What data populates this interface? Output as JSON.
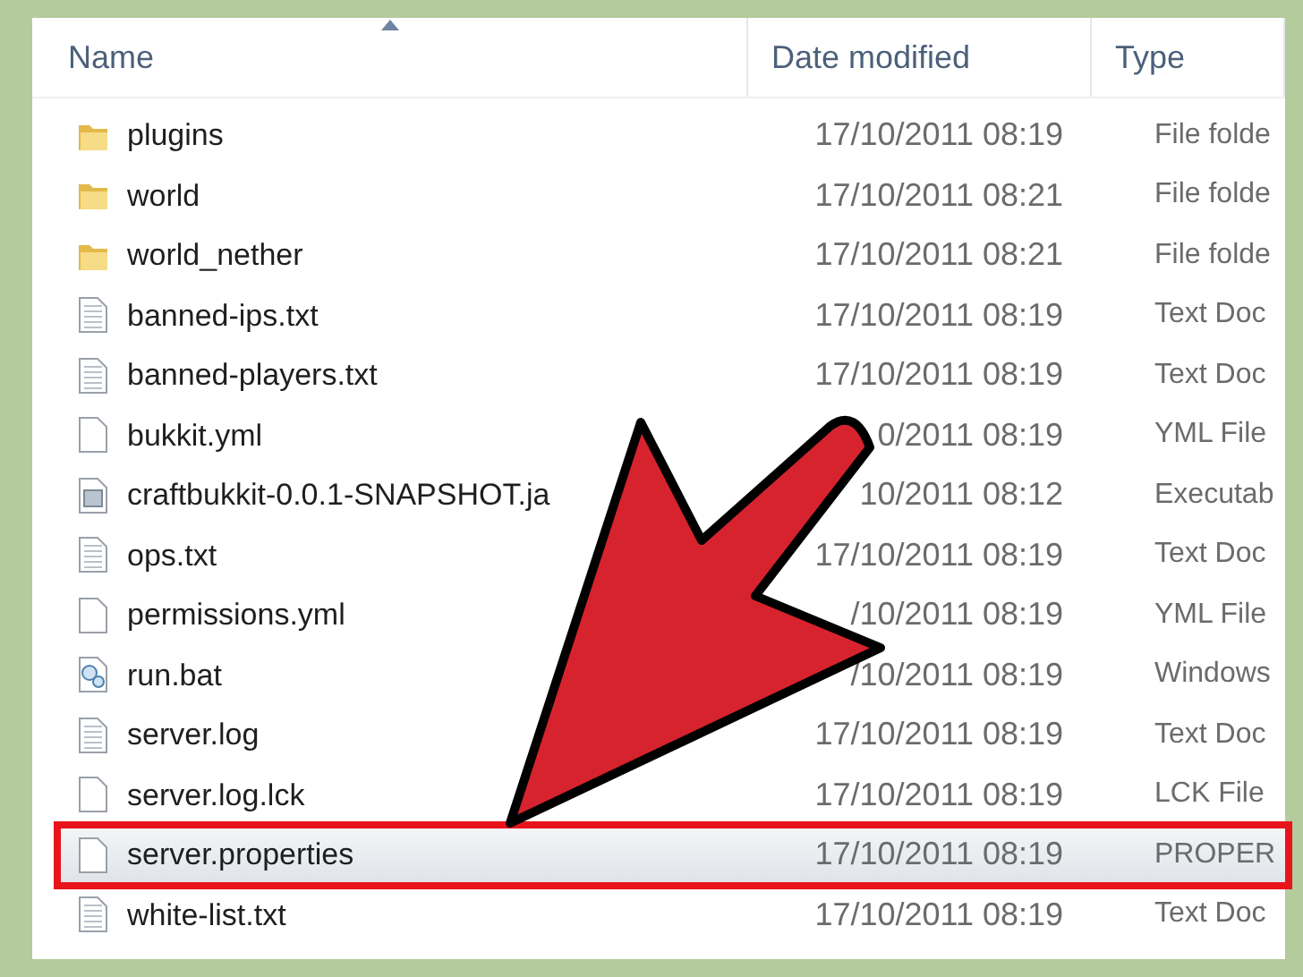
{
  "columns": [
    {
      "label": "Name",
      "sorted": true
    },
    {
      "label": "Date modified",
      "sorted": false
    },
    {
      "label": "Type",
      "sorted": false
    }
  ],
  "rows": [
    {
      "kind": "folder",
      "name": "plugins",
      "date": "17/10/2011 08:19",
      "type": "File folde",
      "selected": false
    },
    {
      "kind": "folder",
      "name": "world",
      "date": "17/10/2011 08:21",
      "type": "File folde",
      "selected": false
    },
    {
      "kind": "folder",
      "name": "world_nether",
      "date": "17/10/2011 08:21",
      "type": "File folde",
      "selected": false
    },
    {
      "kind": "text",
      "name": "banned-ips.txt",
      "date": "17/10/2011 08:19",
      "type": "Text Doc",
      "selected": false
    },
    {
      "kind": "text",
      "name": "banned-players.txt",
      "date": "17/10/2011 08:19",
      "type": "Text Doc",
      "selected": false
    },
    {
      "kind": "blank",
      "name": "bukkit.yml",
      "date": "0/2011 08:19",
      "type": "YML File",
      "selected": false
    },
    {
      "kind": "jar",
      "name": "craftbukkit-0.0.1-SNAPSHOT.ja",
      "date": "10/2011 08:12",
      "type": "Executab",
      "selected": false
    },
    {
      "kind": "text",
      "name": "ops.txt",
      "date": "17/10/2011 08:19",
      "type": "Text Doc",
      "selected": false
    },
    {
      "kind": "blank",
      "name": "permissions.yml",
      "date": "/10/2011 08:19",
      "type": "YML File",
      "selected": false
    },
    {
      "kind": "bat",
      "name": "run.bat",
      "date": "/10/2011 08:19",
      "type": "Windows",
      "selected": false
    },
    {
      "kind": "text",
      "name": "server.log",
      "date": "17/10/2011 08:19",
      "type": "Text Doc",
      "selected": false
    },
    {
      "kind": "blank",
      "name": "server.log.lck",
      "date": "17/10/2011 08:19",
      "type": "LCK File",
      "selected": false
    },
    {
      "kind": "blank",
      "name": "server.properties",
      "date": "17/10/2011 08:19",
      "type": "PROPER",
      "selected": true
    },
    {
      "kind": "text",
      "name": "white-list.txt",
      "date": "17/10/2011 08:19",
      "type": "Text Doc",
      "selected": false
    }
  ]
}
